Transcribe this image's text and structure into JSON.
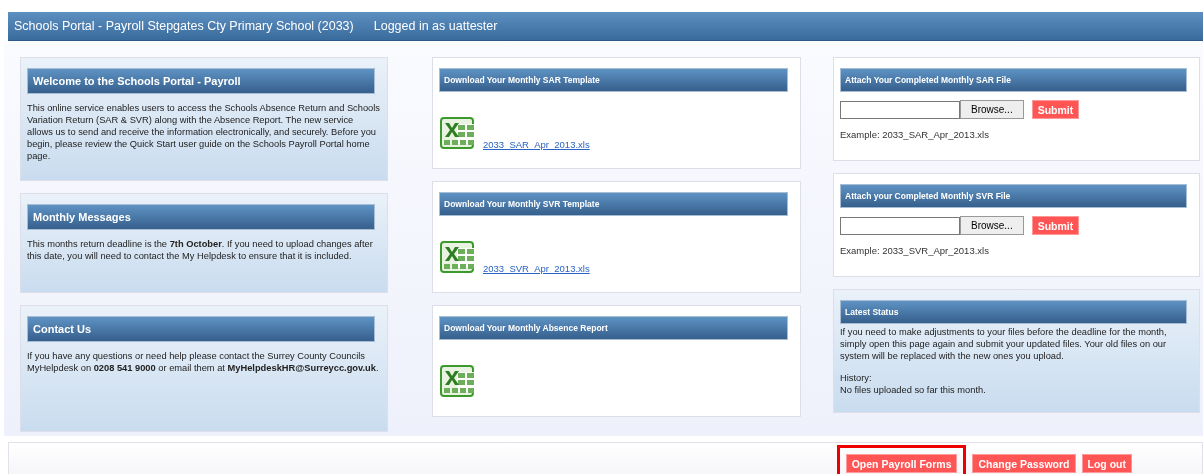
{
  "header": {
    "title": "Schools Portal - Payroll Stepgates Cty Primary School (2033)",
    "user": "Logged in as uattester"
  },
  "columns": [
    {
      "panels": [
        {
          "kind": "info",
          "title": "Welcome to the Schools Portal - Payroll",
          "paragraphs": [
            "This online service enables users to access the Schools Absence Return and Schools Variation Return (SAR & SVR) along with the Absence Report. The new service allows us to send and receive the information electronically, and securely. Before you begin, please review the Quick Start user guide on the Schools Payroll Portal home page."
          ]
        },
        {
          "kind": "info",
          "title": "Monthly Messages",
          "paragraphs": [
            "This months return deadline is the **7th October**. If you need to upload changes after this date, you will need to contact the My Helpdesk to ensure that it is included."
          ]
        },
        {
          "kind": "info",
          "title": "Contact Us",
          "paragraphs": [
            "If you have any questions or need help please contact the Surrey County Councils MyHelpdesk on **0208 541 9000** or email them at **MyHelpdeskHR@Surreycc.gov.uk**."
          ]
        }
      ]
    },
    {
      "panels": [
        {
          "kind": "download",
          "title": "Download Your Monthly SAR Template",
          "link": "2033_SAR_Apr_2013.xls"
        },
        {
          "kind": "download",
          "title": "Download Your Monthly SVR Template",
          "link": "2033_SVR_Apr_2013.xls"
        },
        {
          "kind": "download",
          "title": "Download Your Monthly Absence Report"
        }
      ]
    },
    {
      "panels": [
        {
          "kind": "upload",
          "title": "Attach Your Completed Monthly SAR File",
          "browse": "Browse...",
          "submit": "Submit",
          "example": "Example: 2033_SAR_Apr_2013.xls"
        },
        {
          "kind": "upload",
          "title": "Attach your Completed Monthly SVR File",
          "browse": "Browse...",
          "submit": "Submit",
          "example": "Example: 2033_SVR_Apr_2013.xls"
        },
        {
          "kind": "status",
          "title": "Latest Status",
          "paragraphs": [
            "If you need to make adjustments to your files before the deadline for the month, simply open this page again and submit your updated files. Your old files on our system will be replaced with the new ones you upload.",
            "History:\nNo files uploaded so far this month."
          ]
        }
      ]
    }
  ],
  "footer": {
    "buttons": [
      {
        "label": "Open Payroll Forms",
        "highlighted": true
      },
      {
        "label": "Change Password",
        "highlighted": false
      },
      {
        "label": "Log out",
        "highlighted": false
      }
    ]
  }
}
